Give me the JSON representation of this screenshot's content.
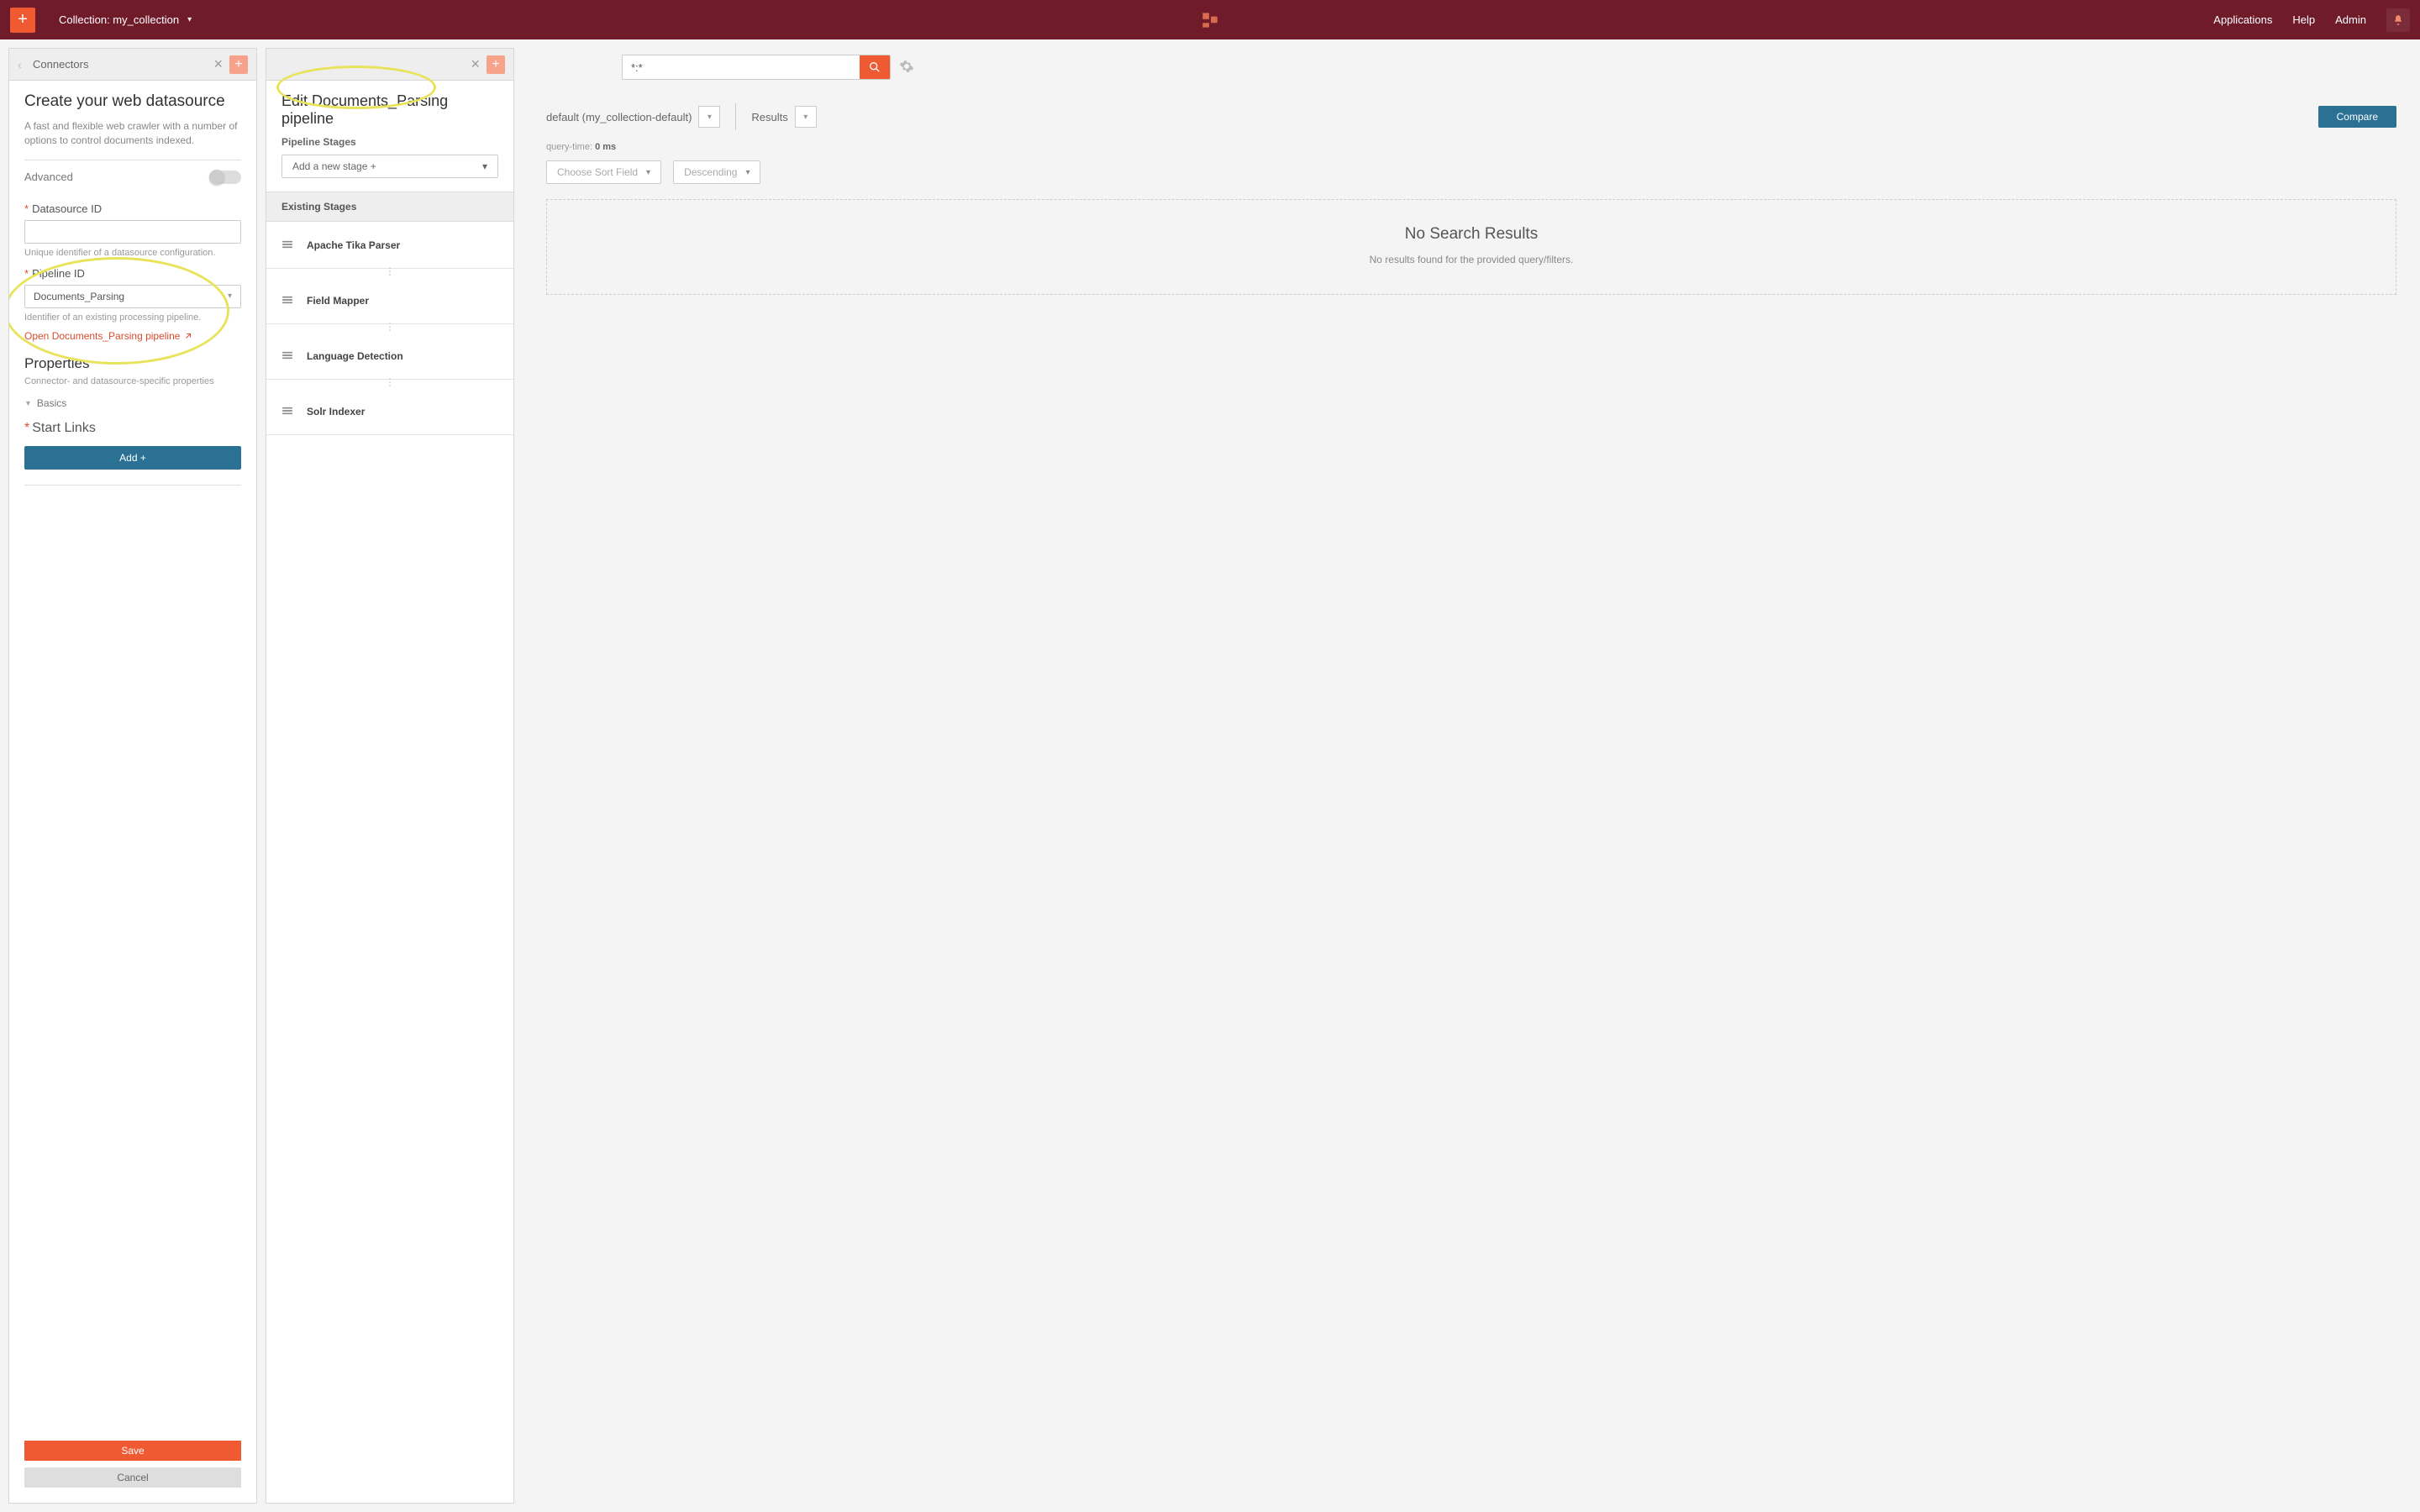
{
  "topbar": {
    "collection_label": "Collection: my_collection",
    "nav": {
      "applications": "Applications",
      "help": "Help",
      "admin": "Admin"
    }
  },
  "left_panel": {
    "header": "Connectors",
    "title": "Create your web datasource",
    "desc": "A fast and flexible web crawler with a number of options to control documents indexed.",
    "advanced_label": "Advanced",
    "datasource_id_label": "Datasource ID",
    "datasource_id_hint": "Unique identifier of a datasource configuration.",
    "pipeline_id_label": "Pipeline ID",
    "pipeline_id_value": "Documents_Parsing",
    "pipeline_id_hint": "Identifier of an existing processing pipeline.",
    "open_pipeline_link": "Open Documents_Parsing pipeline",
    "properties_title": "Properties",
    "properties_desc": "Connector- and datasource-specific properties",
    "basics_label": "Basics",
    "start_links_label": "Start Links",
    "add_btn": "Add +",
    "save_btn": "Save",
    "cancel_btn": "Cancel"
  },
  "mid_panel": {
    "title": "Edit Documents_Parsing pipeline",
    "stages_label": "Pipeline Stages",
    "add_stage": "Add a new stage +",
    "existing_label": "Existing Stages",
    "stages": [
      "Apache Tika Parser",
      "Field Mapper",
      "Language Detection",
      "Solr Indexer"
    ]
  },
  "right_panel": {
    "query_value": "*:*",
    "default_dd": "default (my_collection-default)",
    "results_dd": "Results",
    "compare_btn": "Compare",
    "qtime_label": "query-time: ",
    "qtime_value": "0 ms",
    "sort_field": "Choose Sort Field",
    "sort_dir": "Descending",
    "no_results_title": "No Search Results",
    "no_results_body": "No results found for the provided query/filters."
  }
}
